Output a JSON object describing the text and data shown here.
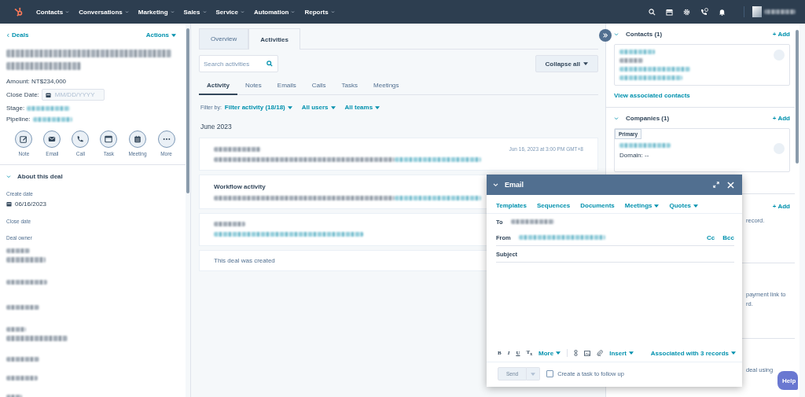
{
  "nav": {
    "items": [
      "Contacts",
      "Conversations",
      "Marketing",
      "Sales",
      "Service",
      "Automation",
      "Reports"
    ]
  },
  "left": {
    "back": "Deals",
    "actions": "Actions",
    "amount": "Amount: NT$234,000",
    "close_date_label": "Close Date:",
    "close_date_placeholder": "MM/DD/YYYY",
    "stage_label": "Stage:",
    "pipeline_label": "Pipeline:",
    "quick_actions": [
      {
        "label": "Note",
        "kind": "note"
      },
      {
        "label": "Email",
        "kind": "email"
      },
      {
        "label": "Call",
        "kind": "call"
      },
      {
        "label": "Task",
        "kind": "task"
      },
      {
        "label": "Meeting",
        "kind": "meeting"
      },
      {
        "label": "More",
        "kind": "more"
      }
    ],
    "about": {
      "title": "About this deal",
      "expanded": true,
      "fields": [
        {
          "label": "Create date",
          "value": "06/16/2023"
        },
        {
          "label": "Close date"
        },
        {
          "label": "Deal owner"
        }
      ]
    }
  },
  "middle": {
    "tabs": [
      {
        "label": "Overview",
        "selected": false
      },
      {
        "label": "Activities",
        "selected": true
      }
    ],
    "search": {
      "placeholder": "Search activities"
    },
    "collapse": "Collapse all",
    "activity_tabs": [
      {
        "label": "Activity",
        "selected": true
      },
      {
        "label": "Notes",
        "selected": false
      },
      {
        "label": "Emails",
        "selected": false
      },
      {
        "label": "Calls",
        "selected": false
      },
      {
        "label": "Tasks",
        "selected": false
      },
      {
        "label": "Meetings",
        "selected": false
      }
    ],
    "filter": {
      "label": "Filter by:",
      "options": [
        "Filter activity (18/18)",
        "All users",
        "All teams"
      ]
    },
    "month": "June 2023",
    "cards": [
      {
        "kind": "entry",
        "timestamp": "Jun 16, 2023 at 3:00 PM GMT+8"
      },
      {
        "kind": "entry",
        "title": "Workflow activity"
      },
      {
        "kind": "entry"
      },
      {
        "kind": "note",
        "text": "This deal was created"
      }
    ]
  },
  "right": {
    "contacts": {
      "title": "Contacts (1)",
      "add": "+ Add",
      "link": "View associated contacts"
    },
    "companies": {
      "title": "Companies (1)",
      "add": "+ Add",
      "badge": "Primary",
      "domain": "Domain: --"
    },
    "sections": [
      {
        "add": "+ Add",
        "lines": [
          "record."
        ]
      },
      {
        "lines": [
          "payment link to",
          "rd."
        ]
      },
      {
        "lines": [
          "deal using"
        ]
      }
    ]
  },
  "email": {
    "title": "Email",
    "tools": [
      {
        "label": "Templates",
        "dropdown": false
      },
      {
        "label": "Sequences",
        "dropdown": false
      },
      {
        "label": "Documents",
        "dropdown": false
      },
      {
        "label": "Meetings",
        "dropdown": true
      },
      {
        "label": "Quotes",
        "dropdown": true
      }
    ],
    "to_label": "To",
    "from_label": "From",
    "cc": "Cc",
    "bcc": "Bcc",
    "subject_label": "Subject",
    "format_buttons": [
      "B",
      "I",
      "U",
      "T$_{x}$"
    ],
    "more": "More",
    "insert": "Insert",
    "associated": "Associated with 3 records",
    "send": {
      "label": "Send",
      "disabled": true
    },
    "follow_up": {
      "label": "Create a task to follow up",
      "checked": false
    }
  },
  "help": "Help"
}
